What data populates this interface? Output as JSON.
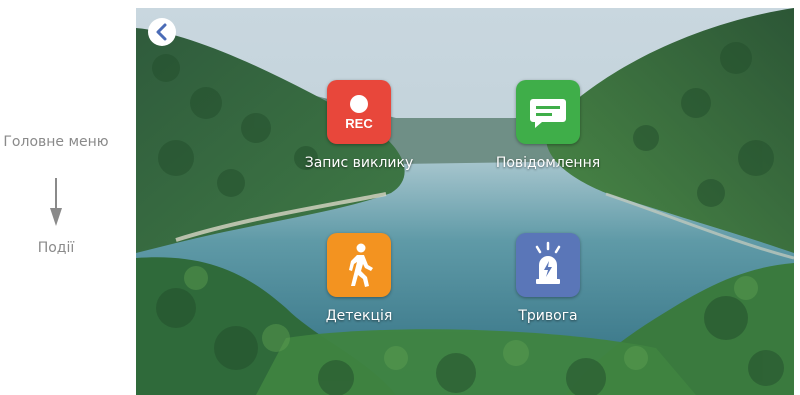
{
  "side": {
    "main_menu": "Головне меню",
    "events": "Події"
  },
  "screen": {
    "back_icon": "chevron-left-icon",
    "tiles": [
      {
        "label": "Запис виклику",
        "icon": "rec-icon",
        "icon_text": "REC",
        "color": "#e8473b"
      },
      {
        "label": "Повідомлення",
        "icon": "message-icon",
        "color": "#3fae49"
      },
      {
        "label": "Детекція",
        "icon": "walking-person-icon",
        "color": "#f39320"
      },
      {
        "label": "Тривога",
        "icon": "siren-icon",
        "color": "#5a76b8"
      }
    ]
  }
}
